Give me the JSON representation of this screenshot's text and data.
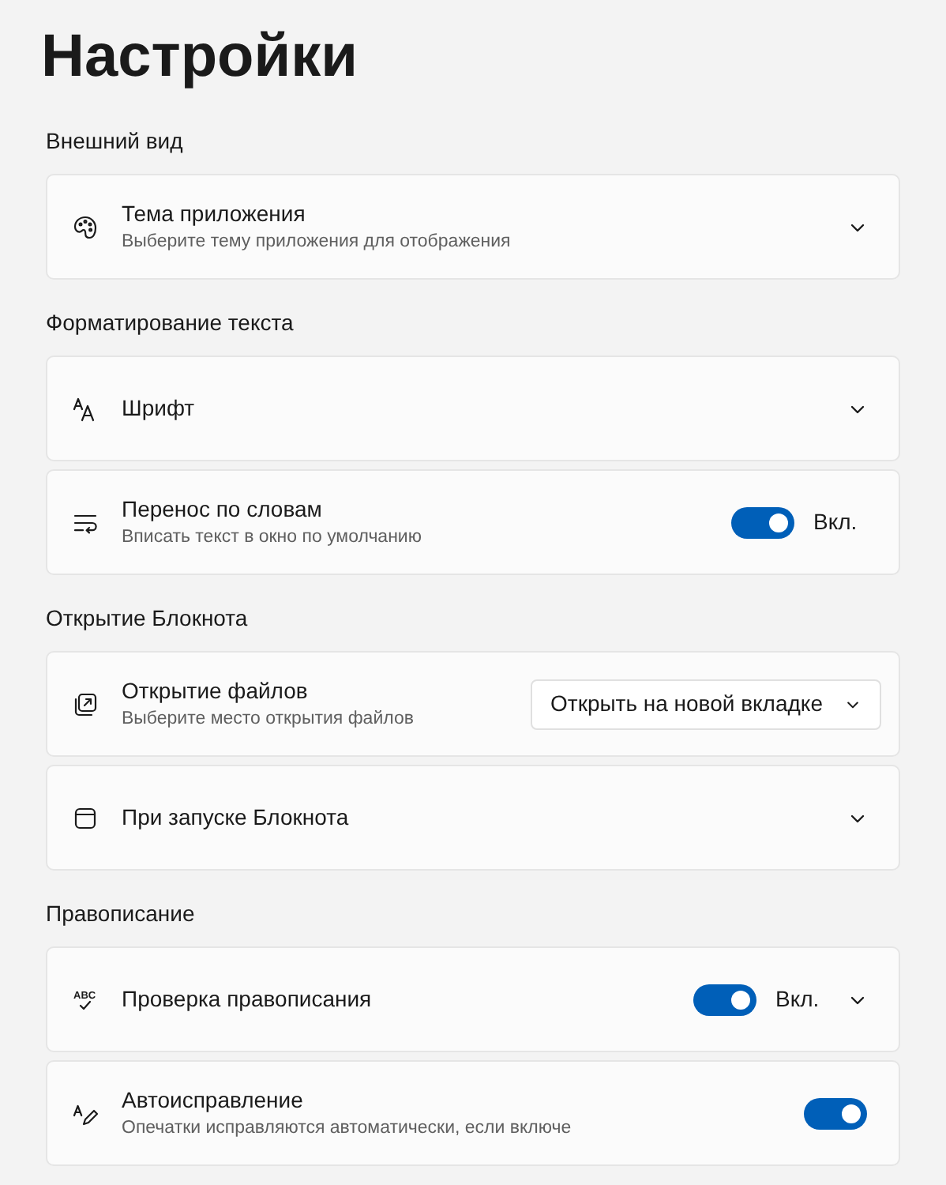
{
  "title": "Настройки",
  "sections": [
    {
      "heading": "Внешний вид",
      "rows": [
        {
          "title": "Тема приложения",
          "description": "Выберите тему приложения для отображения",
          "expandable": true
        }
      ]
    },
    {
      "heading": "Форматирование текста",
      "rows": [
        {
          "title": "Шрифт",
          "expandable": true
        },
        {
          "title": "Перенос по словам",
          "description": "Вписать текст в окно по умолчанию",
          "toggle": {
            "on": true,
            "label": "Вкл."
          }
        }
      ]
    },
    {
      "heading": "Открытие Блокнота",
      "rows": [
        {
          "title": "Открытие файлов",
          "description": "Выберите место открытия файлов",
          "dropdown": {
            "value": "Открыть на новой вкладке"
          }
        },
        {
          "title": "При запуске Блокнота",
          "expandable": true
        }
      ]
    },
    {
      "heading": "Правописание",
      "rows": [
        {
          "title": "Проверка правописания",
          "icon_label": "ABC",
          "toggle": {
            "on": true,
            "label": "Вкл."
          },
          "expandable": true
        },
        {
          "title": "Автоисправление",
          "description": "Опечатки исправляются автоматически, если включе",
          "toggle": {
            "on": true
          }
        }
      ]
    }
  ]
}
